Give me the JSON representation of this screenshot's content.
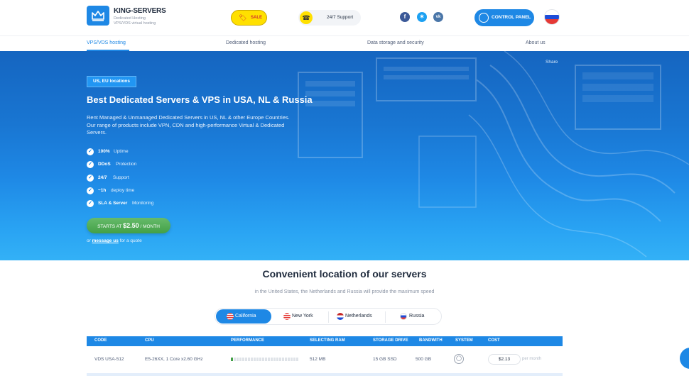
{
  "header": {
    "brand": "KING-SERVERS",
    "brand_sub_1": "Dedicated Hosting",
    "brand_sub_2": "VPS/VDS virtual hosting",
    "sale": "SALE",
    "support": "24/7 Support",
    "control_panel": "CONTROL PANEL",
    "social": [
      "f",
      "t",
      "vk"
    ]
  },
  "nav": {
    "items": [
      {
        "label": "VPS/VDS hosting"
      },
      {
        "label": "Dedicated hosting"
      },
      {
        "label": "Data storage and security"
      },
      {
        "label": "About us"
      }
    ]
  },
  "hero": {
    "share": "Share",
    "badge": "US, EU locations",
    "title": "Best Dedicated Servers & VPS in USA, NL & Russia",
    "description": "Rent Managed & Unmanaged Dedicated Servers in US, NL & other Europe Countries. Our range of products include VPN, CDN and high-performance Virtual & Dedicated Servers.",
    "features": [
      {
        "bold": "100%",
        "rest": "Uptime"
      },
      {
        "bold": "DDoS",
        "rest": "Protection"
      },
      {
        "bold": "24/7",
        "rest": "Support"
      },
      {
        "bold": "~1h",
        "rest": "deploy time"
      },
      {
        "bold": "SLA & Server",
        "rest": "Monitoring"
      }
    ],
    "cta_prefix": "STARTS AT",
    "cta_price": "$2.50",
    "cta_suffix": "/ MONTH",
    "quote_prefix": "or",
    "quote_link": "message us",
    "quote_suffix": "for a quote"
  },
  "locations": {
    "title": "Convenient location of our servers",
    "subtitle": "in the United States, the Netherlands and Russia will provide the maximum speed",
    "tabs": [
      {
        "label": "California",
        "active": true
      },
      {
        "label": "New York",
        "active": false
      },
      {
        "label": "Netherlands",
        "active": false
      },
      {
        "label": "Russia",
        "active": false
      }
    ]
  },
  "table": {
    "headers": [
      "CODE",
      "CPU",
      "PERFORMANCE",
      "SELECTING RAM",
      "STORAGE DRIVE",
      "BANDWITH",
      "SYSTEM",
      "COST"
    ],
    "rows": [
      {
        "code": "VDS USA-512",
        "cpu": "E5-26XX, 1 Core x2.60 GHz",
        "performance": 0.05,
        "ram": "512 MB",
        "storage": "15 GB SSD",
        "bandwidth": "500 GB",
        "system_icon": "linux-icon",
        "cost": "$2.13",
        "per": "per month"
      }
    ]
  },
  "colors": {
    "accent": "#1e88e5",
    "cta": "#43a047",
    "sale": "#ffe000"
  }
}
